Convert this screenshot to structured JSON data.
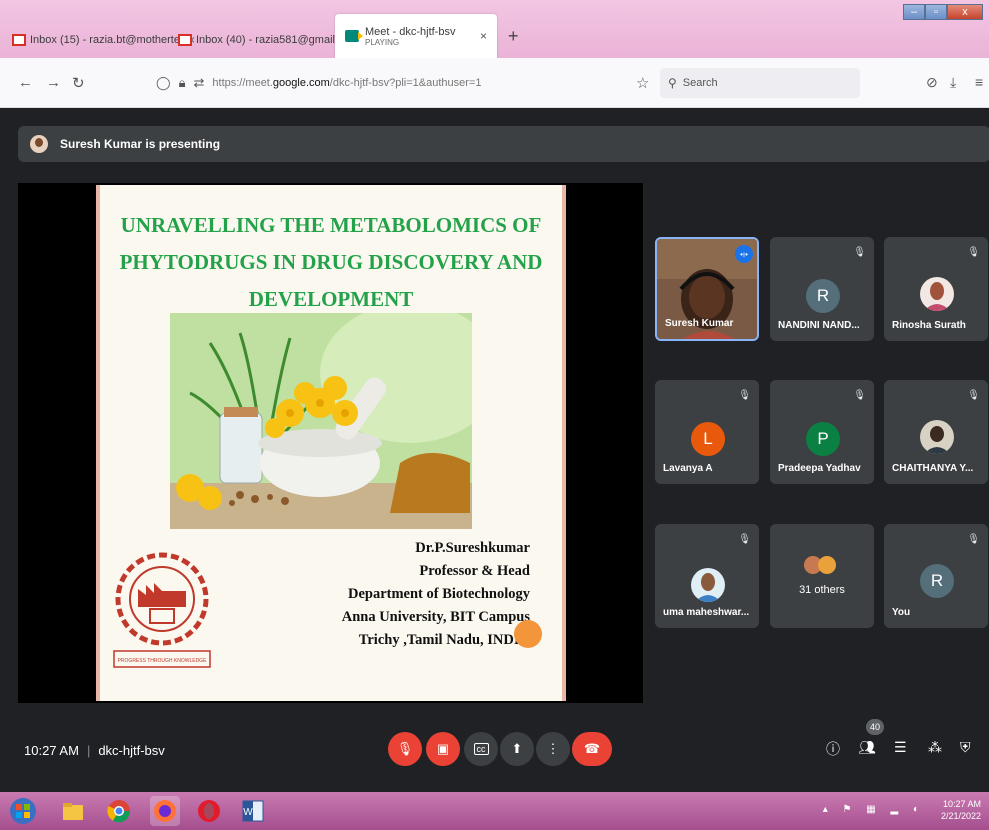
{
  "tabs": [
    {
      "label": "Inbox (15) - razia.bt@motherte",
      "icon": "gmail-icon"
    },
    {
      "label": "Inbox (40) - razia581@gmail.co",
      "icon": "gmail-icon"
    },
    {
      "label": "Meet - dkc-hjtf-bsv",
      "sublabel": "PLAYING",
      "icon": "meet-icon",
      "active": true
    }
  ],
  "browser": {
    "url_prefix": "https://meet.",
    "url_domain": "google.com",
    "url_rest": "/dkc-hjtf-bsv?pli=1&authuser=1",
    "search_placeholder": "Search"
  },
  "presenting": {
    "text": "Suresh Kumar is presenting"
  },
  "slide": {
    "title_line1": "UNRAVELLING THE METABOLOMICS OF",
    "title_line2": "PHYTODRUGS IN DRUG  DISCOVERY AND",
    "title_line3": "DEVELOPMENT",
    "presenter_lines": [
      "Dr.P.Sureshkumar",
      "Professor & Head",
      "Department of Biotechnology",
      "Anna University, BIT Campus",
      "Trichy ,Tamil Nadu, INDIA"
    ],
    "logo_text": "ANNA UNIVERSITY",
    "logo_motto": "PROGRESS THROUGH KNOWLEDGE"
  },
  "participants": [
    {
      "name": "Suresh Kumar",
      "type": "video",
      "speaking": true
    },
    {
      "name": "NANDINI NAND...",
      "letter": "R",
      "color": "#546e7a"
    },
    {
      "name": "Rinosha Surath",
      "type": "photo"
    },
    {
      "name": "Lavanya A",
      "letter": "L",
      "color": "#e8590c"
    },
    {
      "name": "Pradeepa Yadhav",
      "letter": "P",
      "color": "#0b8043"
    },
    {
      "name": "CHAITHANYA Y...",
      "type": "photo"
    },
    {
      "name": "uma maheshwar...",
      "type": "photo"
    },
    {
      "name": "31 others",
      "type": "group"
    },
    {
      "name": "You",
      "letter": "R",
      "color": "#546e7a"
    }
  ],
  "meeting": {
    "time": "10:27 AM",
    "code": "dkc-hjtf-bsv",
    "participant_count": "40"
  },
  "taskbar": {
    "time": "10:27 AM",
    "date": "2/21/2022"
  },
  "colors": {
    "meet_bg": "#202124",
    "tile_bg": "#3c4043",
    "danger": "#ea4335",
    "accent": "#1a73e8",
    "slide_title": "#23a24a"
  }
}
